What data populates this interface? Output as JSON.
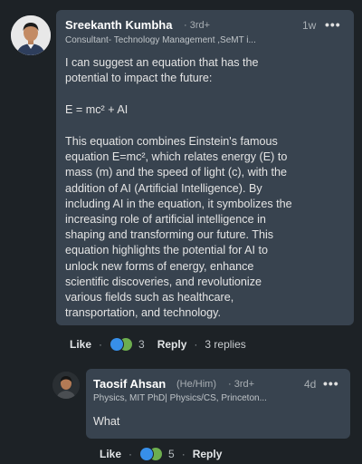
{
  "main_comment": {
    "author": "Sreekanth Kumbha",
    "degree": "· 3rd+",
    "headline": "Consultant- Technology Management ,SeMT i...",
    "time": "1w",
    "more": "•••",
    "paragraphs": [
      [
        "I can suggest an equation that has the",
        "potential to impact the future:"
      ],
      [
        "E = mc² + AI"
      ],
      [
        "This equation combines Einstein's famous",
        "equation E=mc², which relates energy (E) to",
        "mass (m) and the speed of light (c), with the",
        "addition of AI (Artificial Intelligence). By",
        "including AI in the equation, it symbolizes the",
        "increasing role of artificial intelligence in",
        "shaping and transforming our future. This",
        "equation highlights the potential for AI to",
        "unlock new forms of energy, enhance",
        "scientific discoveries, and revolutionize",
        "various fields such as healthcare,",
        "transportation, and technology."
      ]
    ],
    "actions": {
      "like": "Like",
      "reaction_count": "3",
      "reply": "Reply",
      "replies": "3 replies",
      "separator": "·"
    }
  },
  "reply_comment": {
    "author": "Taosif Ahsan",
    "pronouns": "(He/Him)",
    "degree": "· 3rd+",
    "headline": "Physics, MIT PhD| Physics/CS, Princeton...",
    "time": "4d",
    "more": "•••",
    "text": "What",
    "actions": {
      "like": "Like",
      "reaction_count": "5",
      "reply": "Reply",
      "separator": "·"
    }
  },
  "icons": {
    "reactions": [
      "like-icon",
      "clap-icon"
    ],
    "colors": {
      "like": "#378fe9",
      "clap": "#6dae4f",
      "bubble": "#38434f",
      "background": "#1d2226"
    }
  }
}
